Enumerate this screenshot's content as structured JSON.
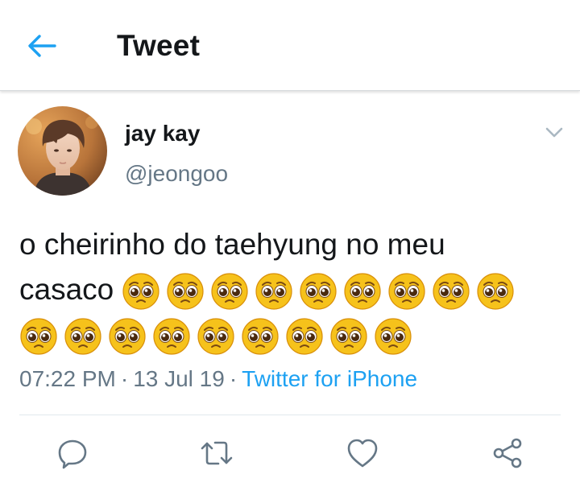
{
  "header": {
    "back_icon": "arrow-left-icon",
    "title": "Tweet"
  },
  "tweet": {
    "display_name": "jay kay",
    "handle": "@jeongoo",
    "text": "o cheirinho do taehyung no meu casaco",
    "text_line1": "o cheirinho do taehyung no meu",
    "text_line2": "casaco",
    "emoji": "🥺",
    "emoji_count": 18,
    "time": "07:22 PM",
    "date": "13 Jul 19",
    "separator": "·",
    "source": "Twitter for iPhone"
  },
  "actions": [
    {
      "name": "reply",
      "icon": "reply-icon"
    },
    {
      "name": "retweet",
      "icon": "retweet-icon"
    },
    {
      "name": "like",
      "icon": "heart-icon"
    },
    {
      "name": "share",
      "icon": "share-icon"
    }
  ],
  "colors": {
    "accent": "#1da1f2",
    "text": "#14171a",
    "secondary": "#657786",
    "icon": "#657786",
    "divider": "#e1e8ed"
  }
}
